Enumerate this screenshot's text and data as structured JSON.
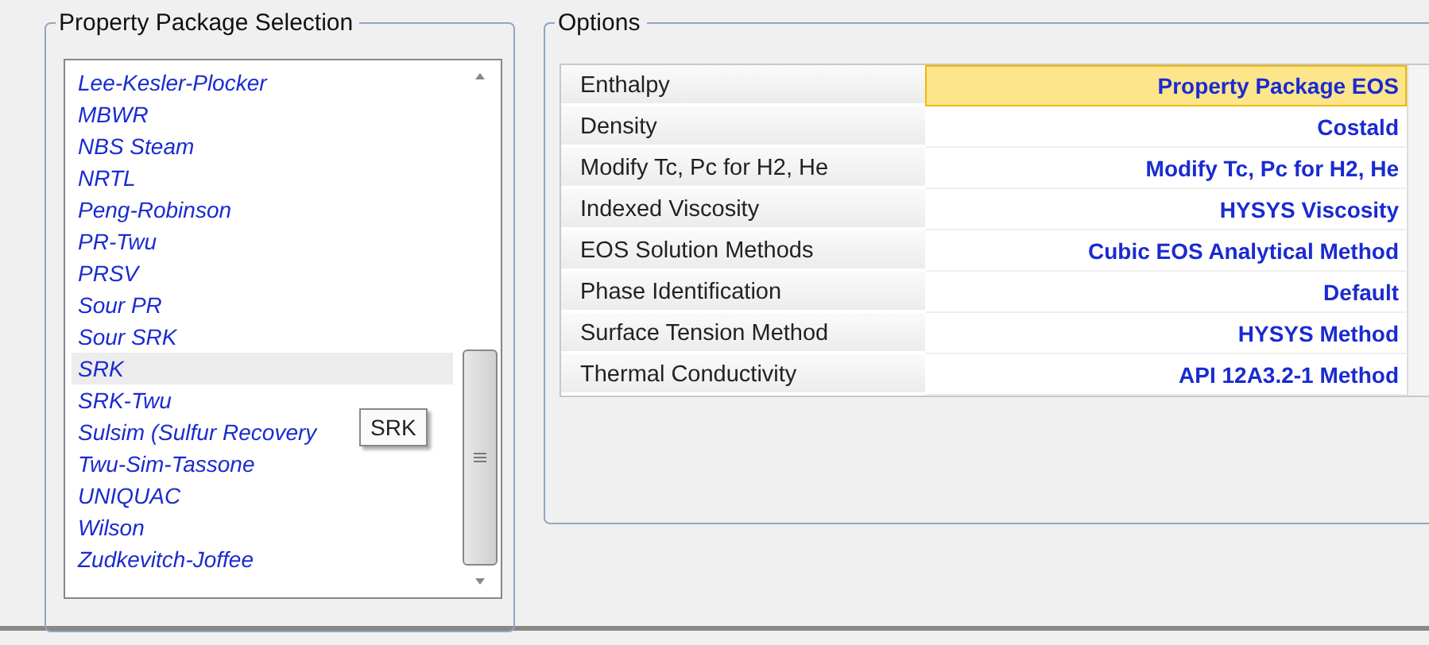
{
  "package_group": {
    "title": "Property Package Selection",
    "items": [
      {
        "label": "Lee-Kesler-Plocker",
        "selected": false
      },
      {
        "label": "MBWR",
        "selected": false
      },
      {
        "label": "NBS Steam",
        "selected": false
      },
      {
        "label": "NRTL",
        "selected": false
      },
      {
        "label": "Peng-Robinson",
        "selected": false
      },
      {
        "label": "PR-Twu",
        "selected": false
      },
      {
        "label": "PRSV",
        "selected": false
      },
      {
        "label": "Sour PR",
        "selected": false
      },
      {
        "label": "Sour SRK",
        "selected": false
      },
      {
        "label": "SRK",
        "selected": true
      },
      {
        "label": "SRK-Twu",
        "selected": false
      },
      {
        "label": "Sulsim (Sulfur Recovery",
        "selected": false
      },
      {
        "label": "Twu-Sim-Tassone",
        "selected": false
      },
      {
        "label": "UNIQUAC",
        "selected": false
      },
      {
        "label": "Wilson",
        "selected": false
      },
      {
        "label": "Zudkevitch-Joffee",
        "selected": false
      }
    ],
    "tooltip": "SRK"
  },
  "options_group": {
    "title": "Options",
    "rows": [
      {
        "label": "Enthalpy",
        "value": "Property Package EOS",
        "selected": true
      },
      {
        "label": "Density",
        "value": "Costald",
        "selected": false
      },
      {
        "label": "Modify Tc, Pc for H2, He",
        "value": "Modify Tc, Pc for H2, He",
        "selected": false
      },
      {
        "label": "Indexed Viscosity",
        "value": "HYSYS Viscosity",
        "selected": false
      },
      {
        "label": "EOS Solution Methods",
        "value": "Cubic EOS Analytical Method",
        "selected": false
      },
      {
        "label": "Phase Identification",
        "value": "Default",
        "selected": false
      },
      {
        "label": "Surface Tension Method",
        "value": "HYSYS Method",
        "selected": false
      },
      {
        "label": "Thermal Conductivity",
        "value": "API 12A3.2-1 Method",
        "selected": false
      }
    ]
  }
}
